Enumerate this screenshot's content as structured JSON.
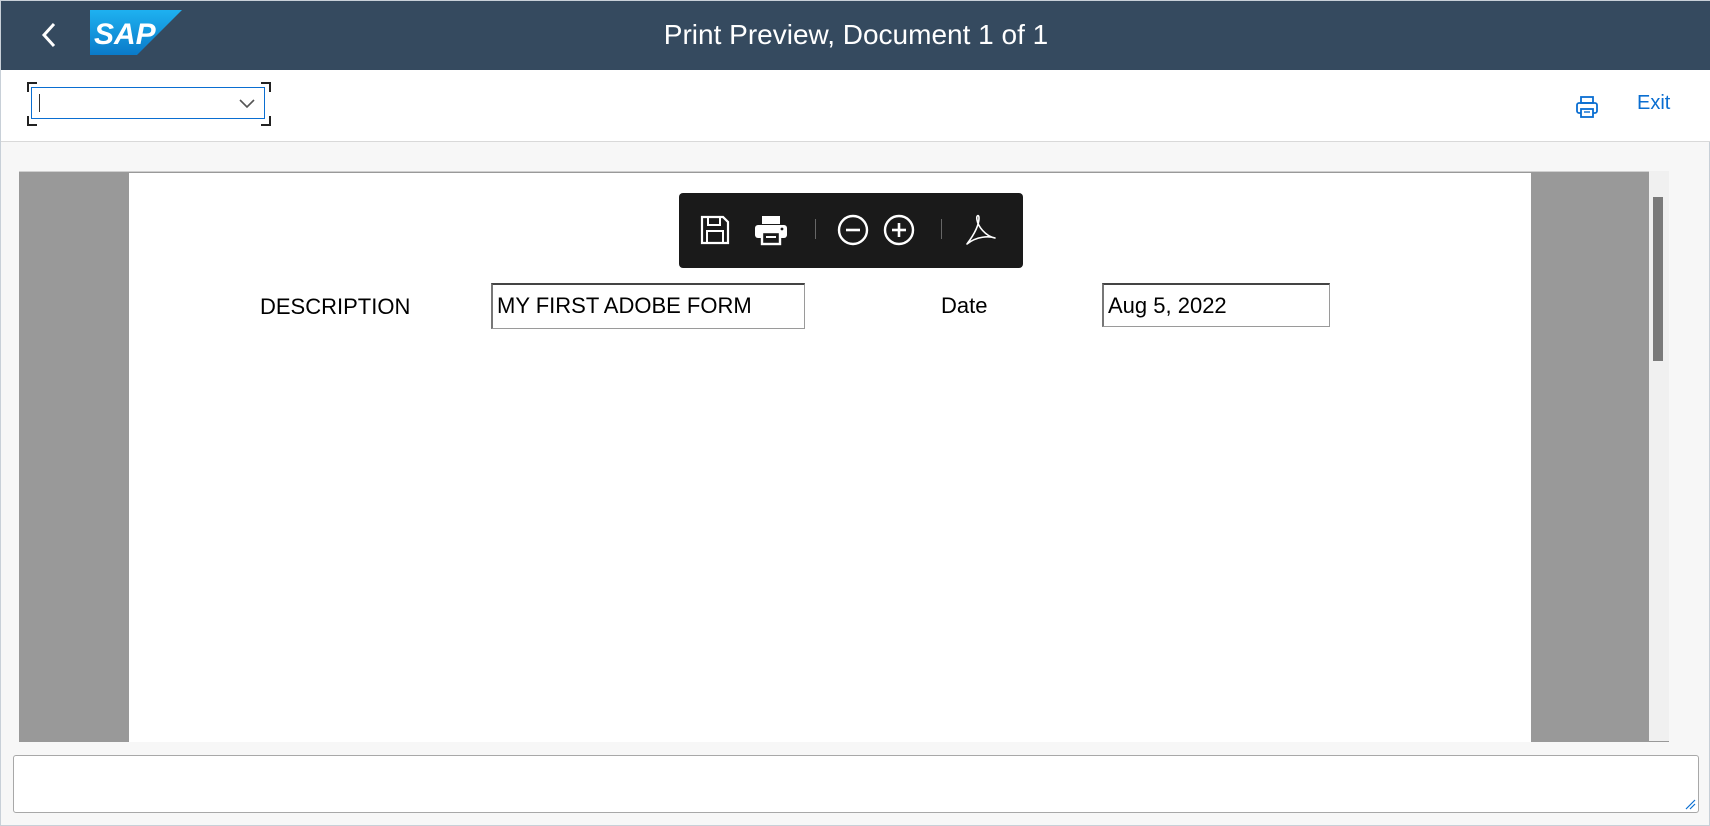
{
  "shell": {
    "title": "Print Preview, Document 1 of 1",
    "logo_text": "SAP",
    "back_icon": "chevron-left-icon",
    "brand_color": "#354a5f"
  },
  "toolbar": {
    "combo_value": "",
    "print_icon": "printer-icon",
    "exit_label": "Exit",
    "accent": "#0a6ed1"
  },
  "pdf_toolbar": {
    "icons": [
      "save-icon",
      "print-icon",
      "zoom-out-icon",
      "zoom-in-icon",
      "adobe-acrobat-icon"
    ]
  },
  "form": {
    "description_label": "DESCRIPTION",
    "description_value": "MY FIRST ADOBE FORM",
    "date_label": "Date",
    "date_value": "Aug 5, 2022"
  },
  "status_bar": {
    "text": ""
  }
}
